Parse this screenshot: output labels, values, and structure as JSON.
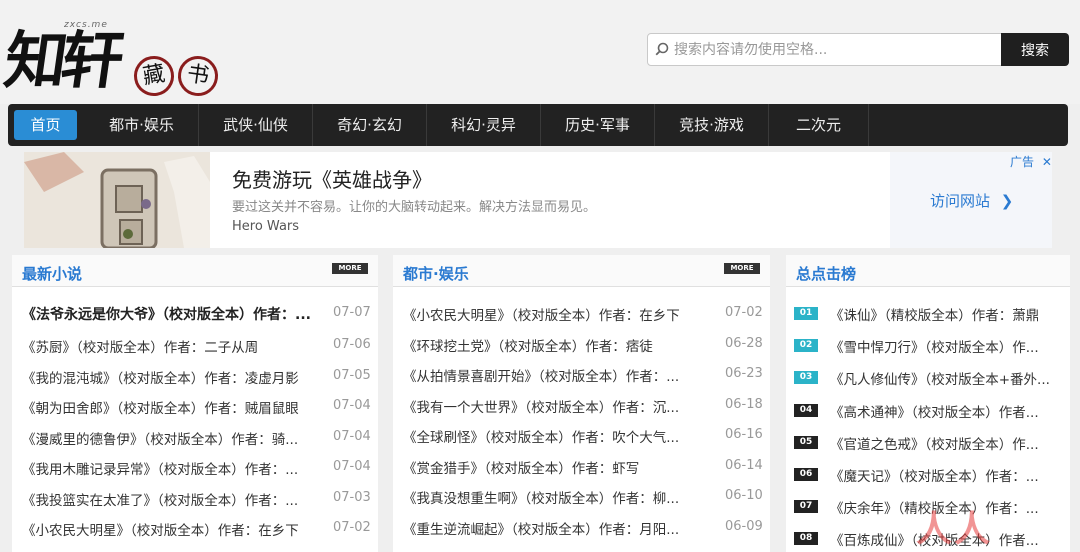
{
  "logo": {
    "title": "知轩",
    "seal": [
      "藏",
      "书"
    ],
    "domain": "zxcs.me"
  },
  "search": {
    "placeholder": "搜索内容请勿使用空格...",
    "button_label": "搜索"
  },
  "nav": [
    {
      "label": "首页",
      "active": true
    },
    {
      "label": "都市·娱乐"
    },
    {
      "label": "武侠·仙侠"
    },
    {
      "label": "奇幻·玄幻"
    },
    {
      "label": "科幻·灵异"
    },
    {
      "label": "历史·军事"
    },
    {
      "label": "竞技·游戏"
    },
    {
      "label": "二次元"
    }
  ],
  "ad": {
    "title": "免费游玩《英雄战争》",
    "desc": "要过这关并不容易。让你的大脑转动起来。解决方法显而易见。",
    "brand": "Hero Wars",
    "visit_label": "访问网站",
    "tag_label": "广告"
  },
  "latest": {
    "title": "最新小说",
    "more_label": "MORE",
    "items": [
      {
        "title": "《法爷永远是你大爷》（校对版全本）作者：...",
        "date": "07-07"
      },
      {
        "title": "《苏厨》（校对版全本）作者：二子从周",
        "date": "07-06"
      },
      {
        "title": "《我的混沌城》（校对版全本）作者：凌虚月影",
        "date": "07-05"
      },
      {
        "title": "《朝为田舍郎》（校对版全本）作者：贼眉鼠眼",
        "date": "07-04"
      },
      {
        "title": "《漫威里的德鲁伊》（校对版全本）作者：骑...",
        "date": "07-04"
      },
      {
        "title": "《我用木雕记录异常》（校对版全本）作者：...",
        "date": "07-04"
      },
      {
        "title": "《我投篮实在太准了》（校对版全本）作者：...",
        "date": "07-03"
      },
      {
        "title": "《小农民大明星》（校对版全本）作者：在乡下",
        "date": "07-02"
      }
    ]
  },
  "urban": {
    "title": "都市·娱乐",
    "more_label": "MORE",
    "items": [
      {
        "title": "《小农民大明星》（校对版全本）作者：在乡下",
        "date": "07-02"
      },
      {
        "title": "《环球挖土党》（校对版全本）作者：痞徒",
        "date": "06-28"
      },
      {
        "title": "《从拍情景喜剧开始》（校对版全本）作者：...",
        "date": "06-23"
      },
      {
        "title": "《我有一个大世界》（校对版全本）作者：沉...",
        "date": "06-18"
      },
      {
        "title": "《全球刷怪》（校对版全本）作者：吹个大气...",
        "date": "06-16"
      },
      {
        "title": "《赏金猎手》（校对版全本）作者：虾写",
        "date": "06-14"
      },
      {
        "title": "《我真没想重生啊》（校对版全本）作者：柳...",
        "date": "06-10"
      },
      {
        "title": "《重生逆流崛起》（校对版全本）作者：月阳...",
        "date": "06-09"
      }
    ]
  },
  "ranking": {
    "title": "总点击榜",
    "items": [
      {
        "rank": "01",
        "title": "《诛仙》（精校版全本）作者：萧鼎"
      },
      {
        "rank": "02",
        "title": "《雪中悍刀行》（校对版全本）作..."
      },
      {
        "rank": "03",
        "title": "《凡人修仙传》（校对版全本+番外..."
      },
      {
        "rank": "04",
        "title": "《高术通神》（校对版全本）作者..."
      },
      {
        "rank": "05",
        "title": "《官道之色戒》（校对版全本）作..."
      },
      {
        "rank": "06",
        "title": "《魔天记》（校对版全本）作者：..."
      },
      {
        "rank": "07",
        "title": "《庆余年》（精校版全本）作者：..."
      },
      {
        "rank": "08",
        "title": "《百炼成仙》（校对版全本）作者..."
      }
    ]
  },
  "watermark": "人人都是产品经理",
  "colors": {
    "accent": "#2a8dd5",
    "nav_bg": "#222222",
    "rank_top": "#2bb3c8"
  }
}
